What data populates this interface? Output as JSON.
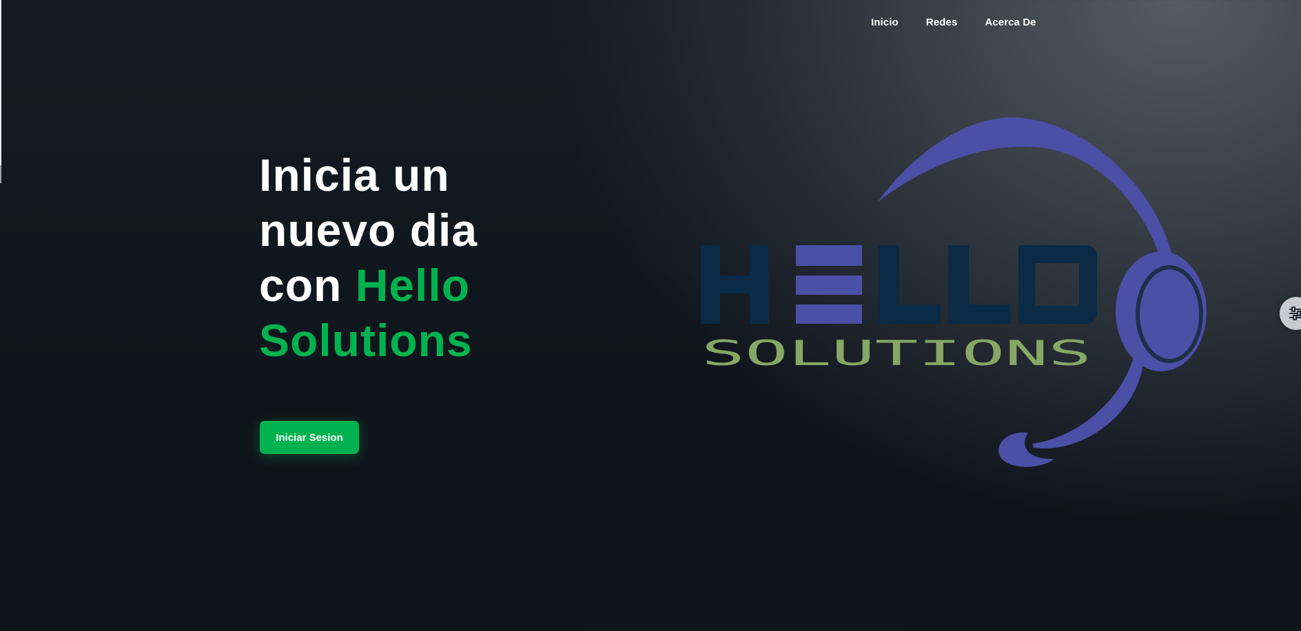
{
  "nav": {
    "items": [
      {
        "label": "Inicio"
      },
      {
        "label": "Redes"
      },
      {
        "label": "Acerca De"
      }
    ]
  },
  "hero": {
    "line1": "Inicia un",
    "line2": "nuevo dia",
    "line3_prefix": "con ",
    "brand_word1": "Hello",
    "brand_word2": "Solutions",
    "cta_label": "Iniciar Sesion"
  },
  "logo": {
    "word_main": "HELLO",
    "word_sub": "SOLUTIONS",
    "icon": "headset-icon"
  },
  "settings": {
    "icon": "sliders-icon"
  },
  "colors": {
    "accent_green": "#00b24f",
    "logo_purple": "#4b4fa6",
    "logo_navy": "#0a2a45",
    "logo_sage": "#86a864"
  }
}
